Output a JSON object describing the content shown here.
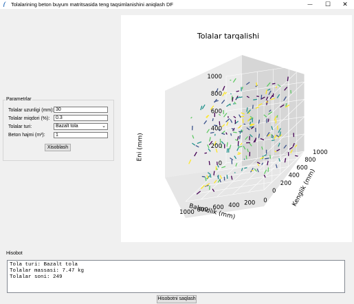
{
  "window": {
    "title": "Tolalarining beton buyum matritsasida teng taqsimlanishini aniqlash DF",
    "minimize_glyph": "—",
    "maximize_glyph": "☐",
    "close_glyph": "✕"
  },
  "params": {
    "group_label": "Parametrlar",
    "length_label": "Tolalar uzunligi (mm):",
    "length_value": "30",
    "amount_label": "Tolalar miqdori (%):",
    "amount_value": "0.3",
    "type_label": "Tolalar turi:",
    "type_value": "Bazalt tola",
    "volume_label": "Beton hajmi (m³):",
    "volume_value": "1",
    "calc_button": "Xisoblash"
  },
  "report": {
    "group_label": "Hisobot",
    "lines": [
      "Tola turi: Bazalt tola",
      "Tolalar massasi: 7.47 kg",
      "Tolalar soni: 249"
    ],
    "save_button": "Hisobotni saqlash"
  },
  "chart_data": {
    "type": "scatter3d",
    "title": "Tolalar tarqalishi",
    "xlabel": "Balandlik (mm)",
    "ylabel": "Kenglik (mm)",
    "zlabel": "Eni (mm)",
    "x_ticks": [
      0,
      200,
      400,
      600,
      800,
      1000
    ],
    "y_ticks": [
      0,
      200,
      400,
      600,
      800,
      1000
    ],
    "z_ticks": [
      0,
      200,
      400,
      600,
      800,
      1000
    ],
    "xlim": [
      0,
      1000
    ],
    "ylim": [
      0,
      1000
    ],
    "zlim": [
      0,
      1000
    ],
    "grid": true,
    "fiber_count": 249,
    "fiber_length_mm": 30,
    "colors": [
      "#440154",
      "#3b528b",
      "#21918c",
      "#5ec962",
      "#fde725"
    ]
  }
}
